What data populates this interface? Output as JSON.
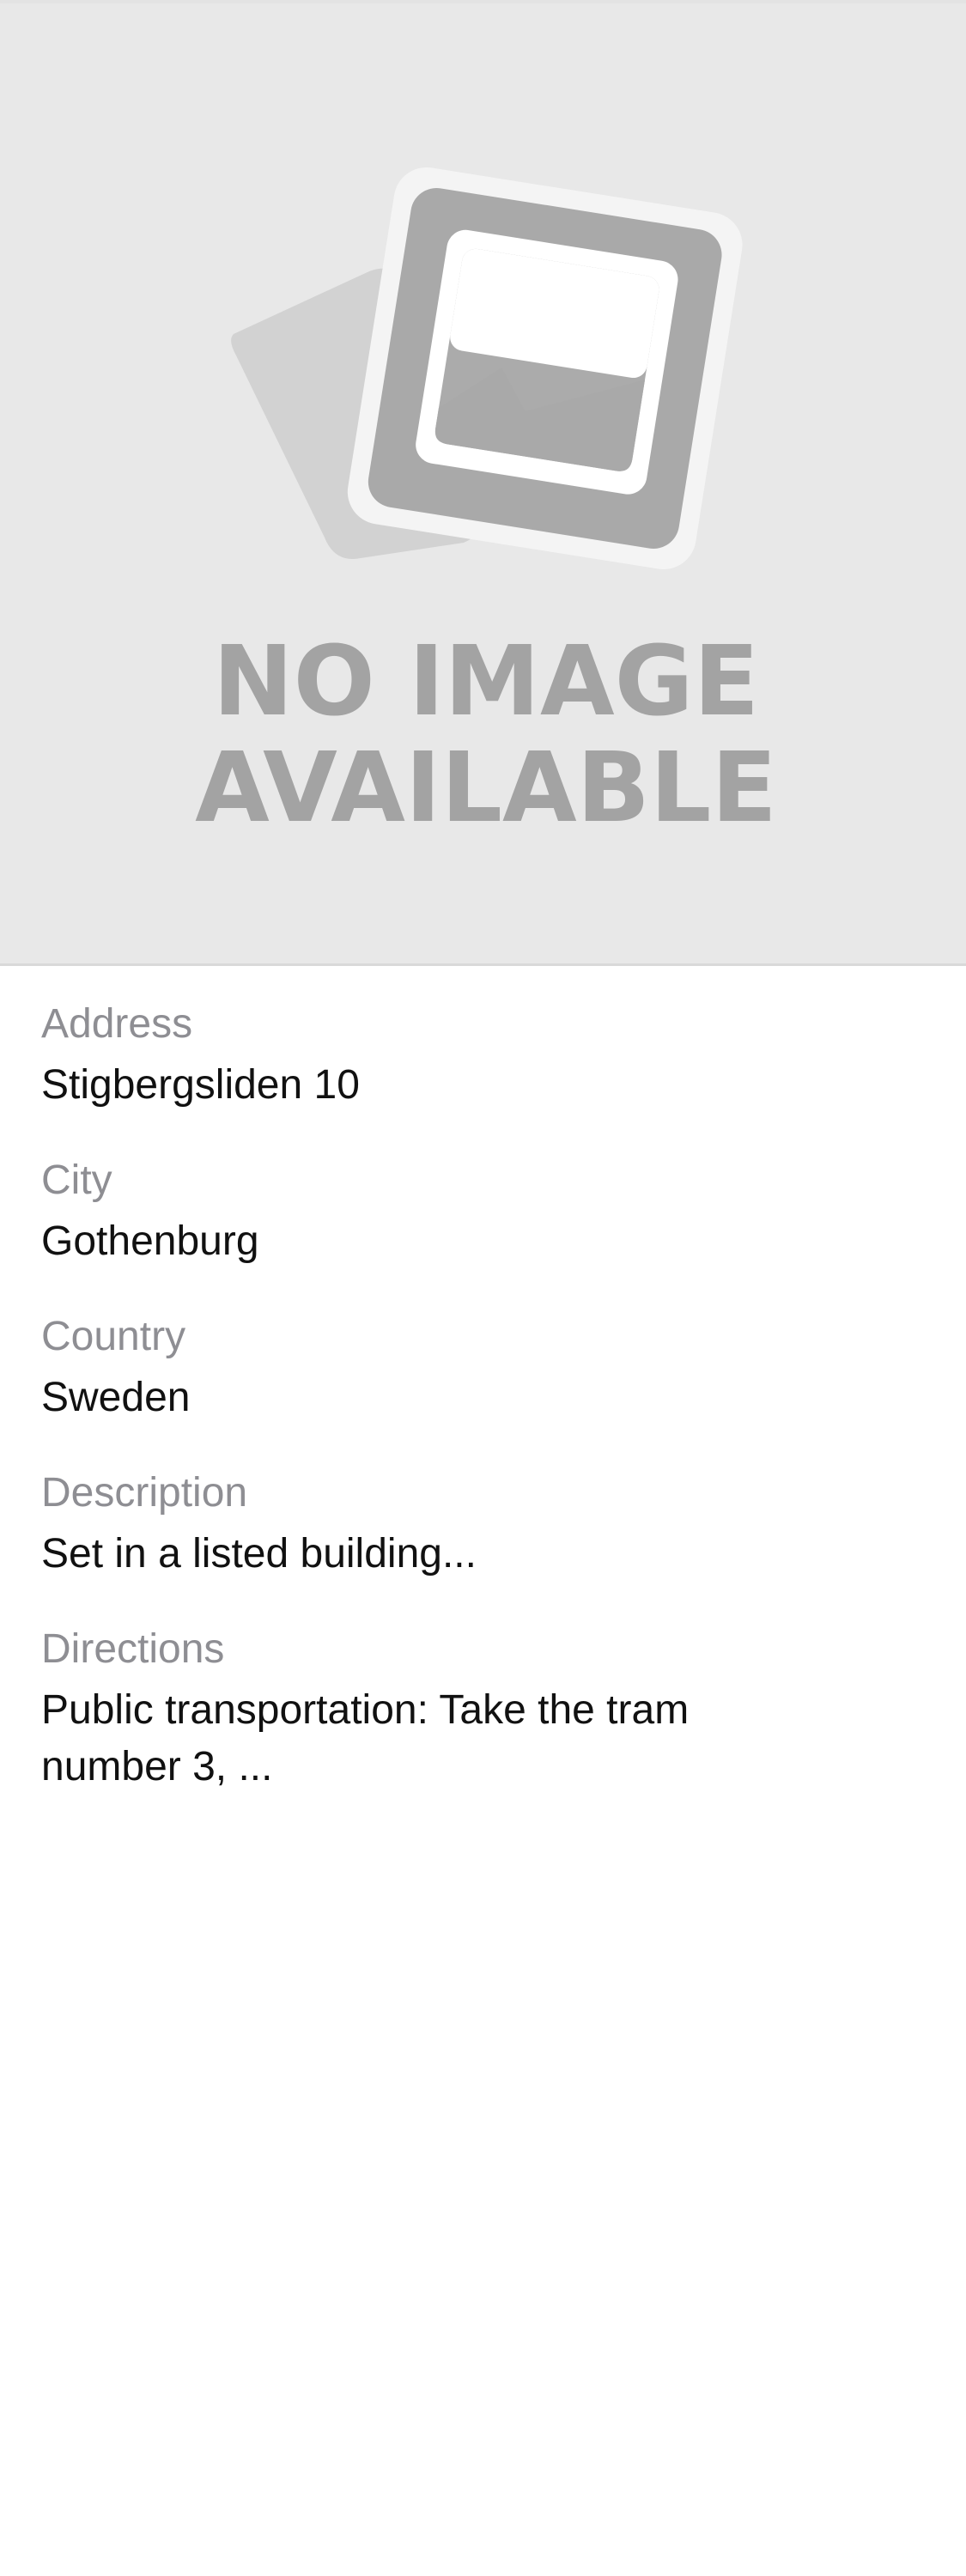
{
  "image": {
    "placeholder_line1": "NO IMAGE",
    "placeholder_line2": "AVAILABLE"
  },
  "fields": [
    {
      "label": "Address",
      "value": "Stigbergsliden 10"
    },
    {
      "label": "City",
      "value": "Gothenburg"
    },
    {
      "label": "Country",
      "value": "Sweden"
    },
    {
      "label": "Description",
      "value": "Set in a listed building..."
    },
    {
      "label": "Directions",
      "value": "Public transportation: Take the tram number 3, ..."
    }
  ]
}
